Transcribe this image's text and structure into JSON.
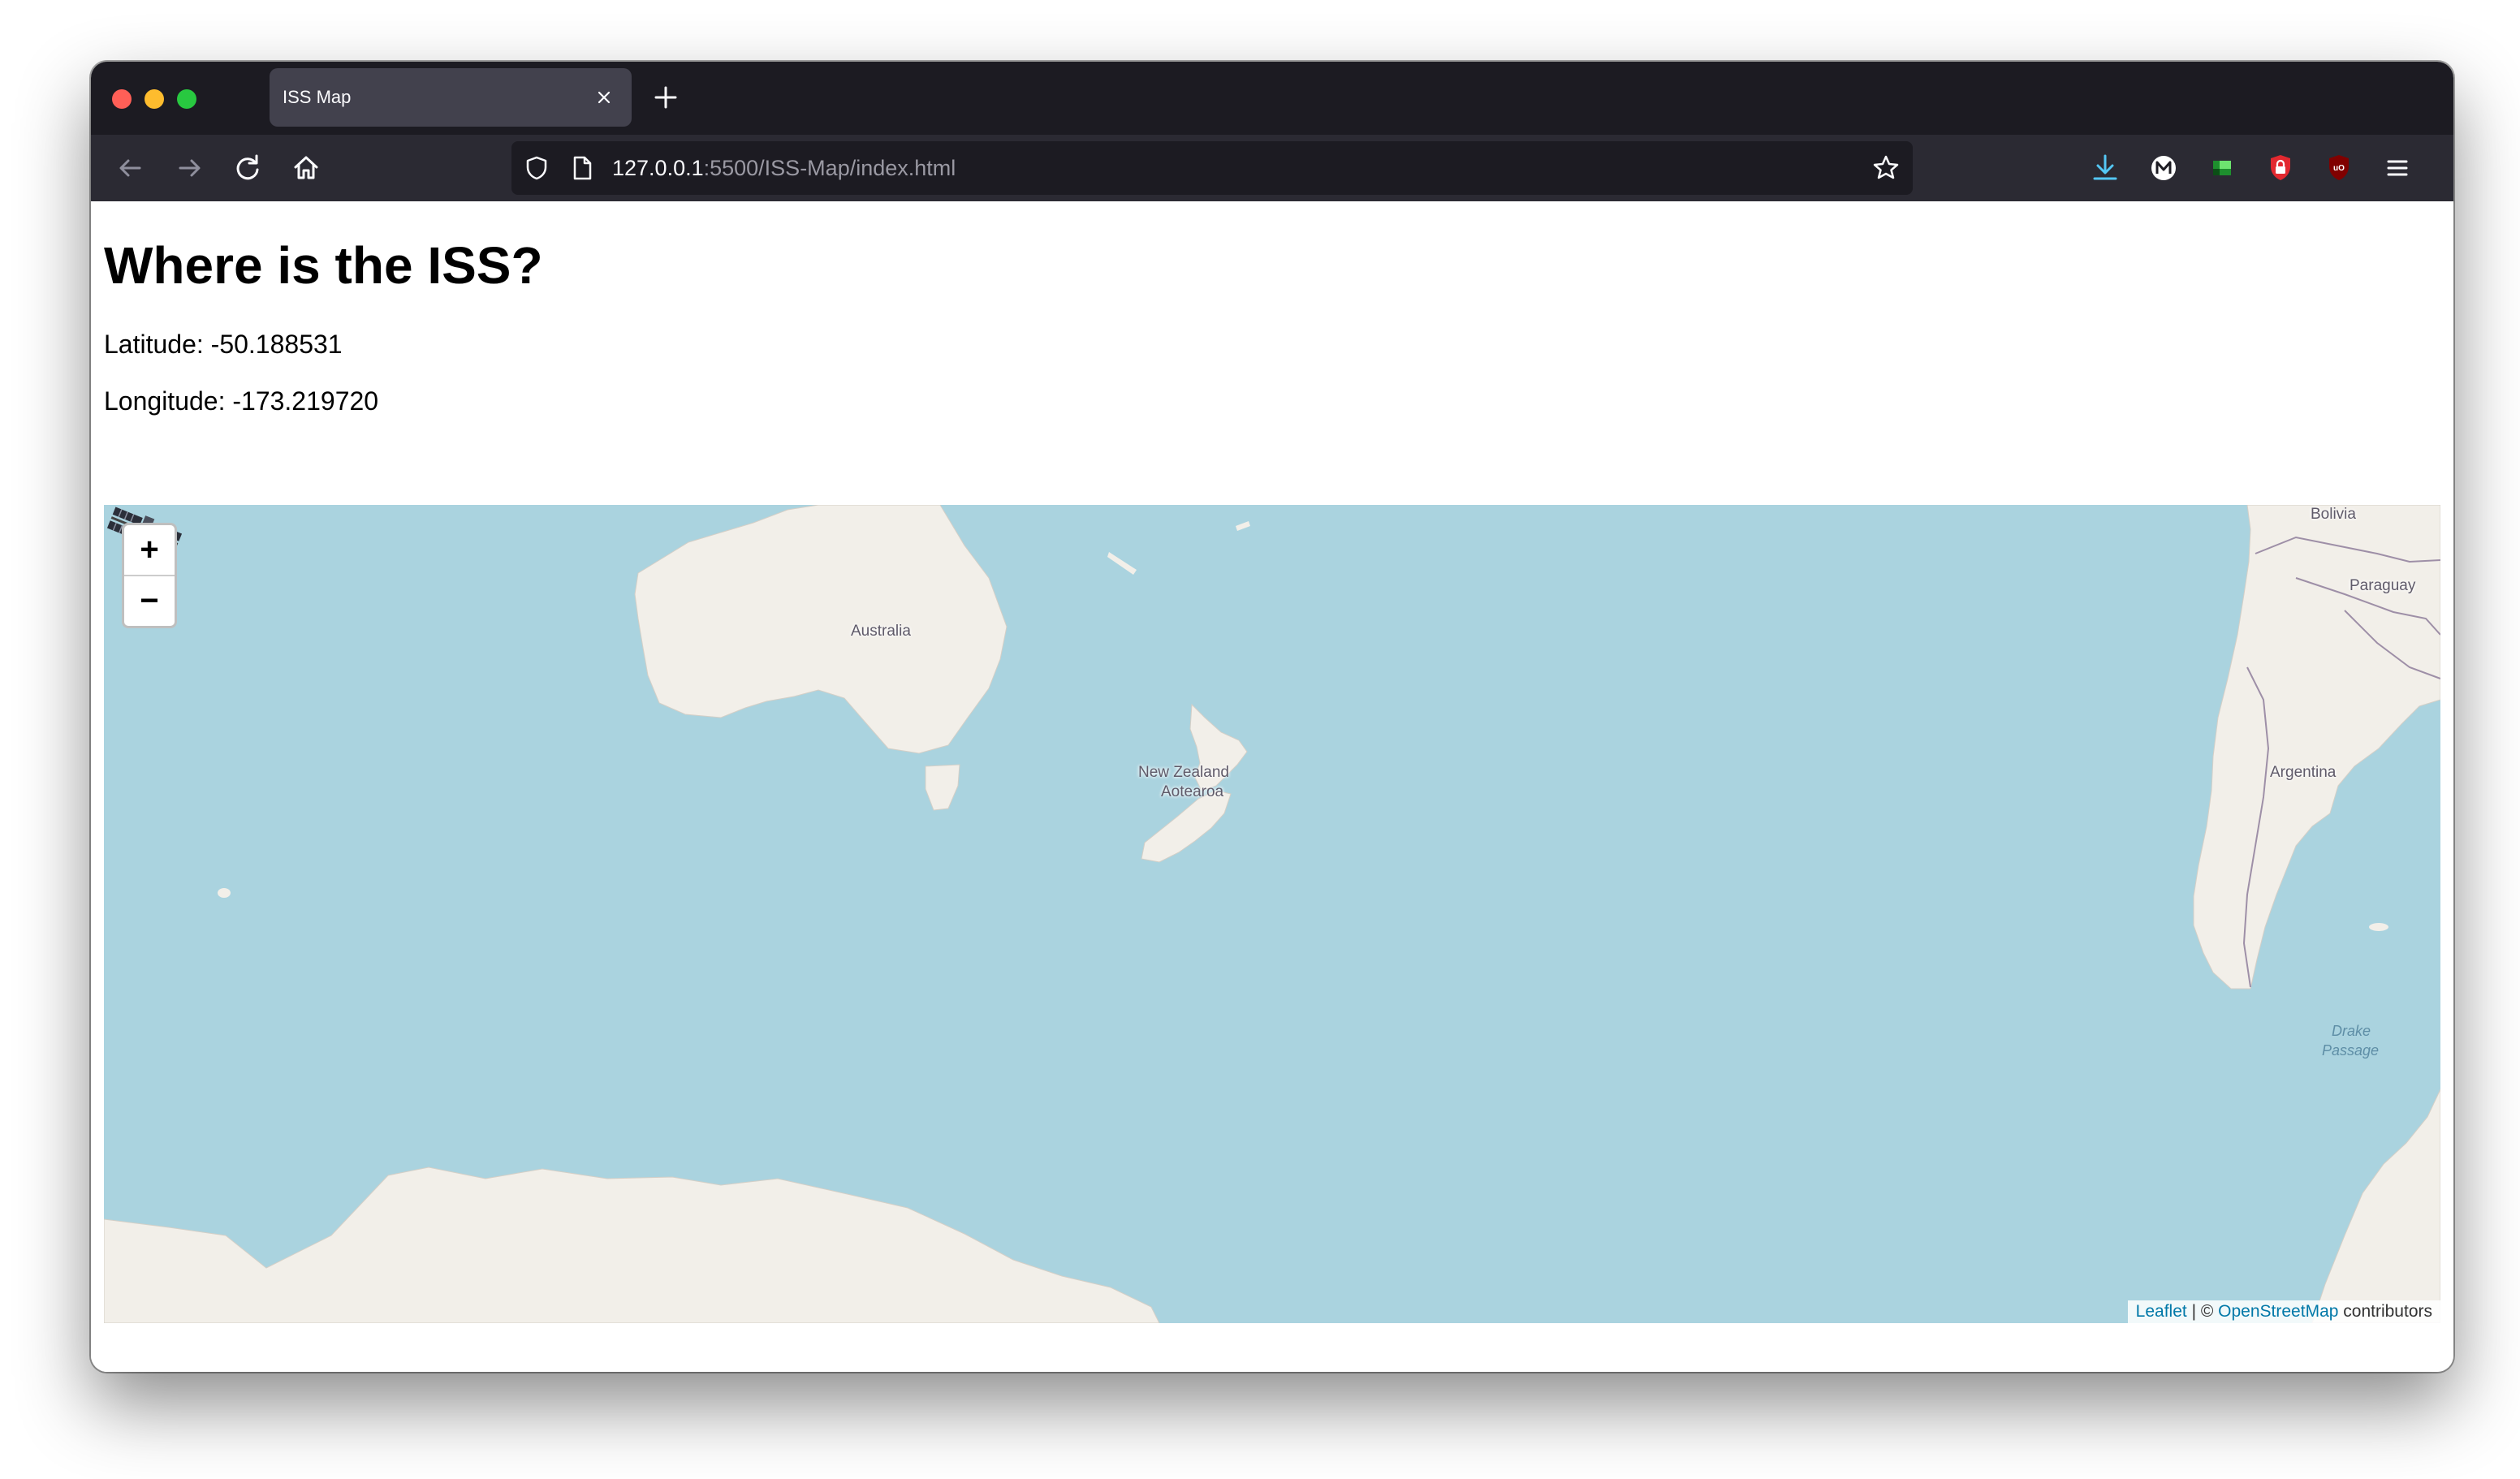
{
  "browser": {
    "tab_title": "ISS Map",
    "url_host": "127.0.0.1",
    "url_rest": ":5500/ISS-Map/index.html",
    "icons": [
      "back-icon",
      "forward-icon",
      "reload-icon",
      "home-icon",
      "shield-icon",
      "page-icon",
      "star-icon",
      "download-icon",
      "m-extension-icon",
      "green-extension-icon",
      "lock-extension-icon",
      "ublock-icon",
      "menu-icon"
    ]
  },
  "page": {
    "title": "Where is the ISS?",
    "latitude_label": "Latitude: -50.188531",
    "longitude_label": "Longitude: -173.219720"
  },
  "map": {
    "zoom_in": "+",
    "zoom_out": "−",
    "labels": {
      "australia": "Australia",
      "new_zealand": "New Zealand",
      "aotearoa": "Aotearoa",
      "bolivia": "Bolivia",
      "paraguay": "Paraguay",
      "argentina": "Argentina",
      "drake_1": "Drake",
      "drake_2": "Passage"
    },
    "attribution": {
      "leaflet": "Leaflet",
      "separator": " | © ",
      "osm": "OpenStreetMap",
      "suffix": " contributors"
    },
    "colors": {
      "water": "#aad3df",
      "land": "#f2efe9",
      "border": "#9e8fa7"
    }
  }
}
